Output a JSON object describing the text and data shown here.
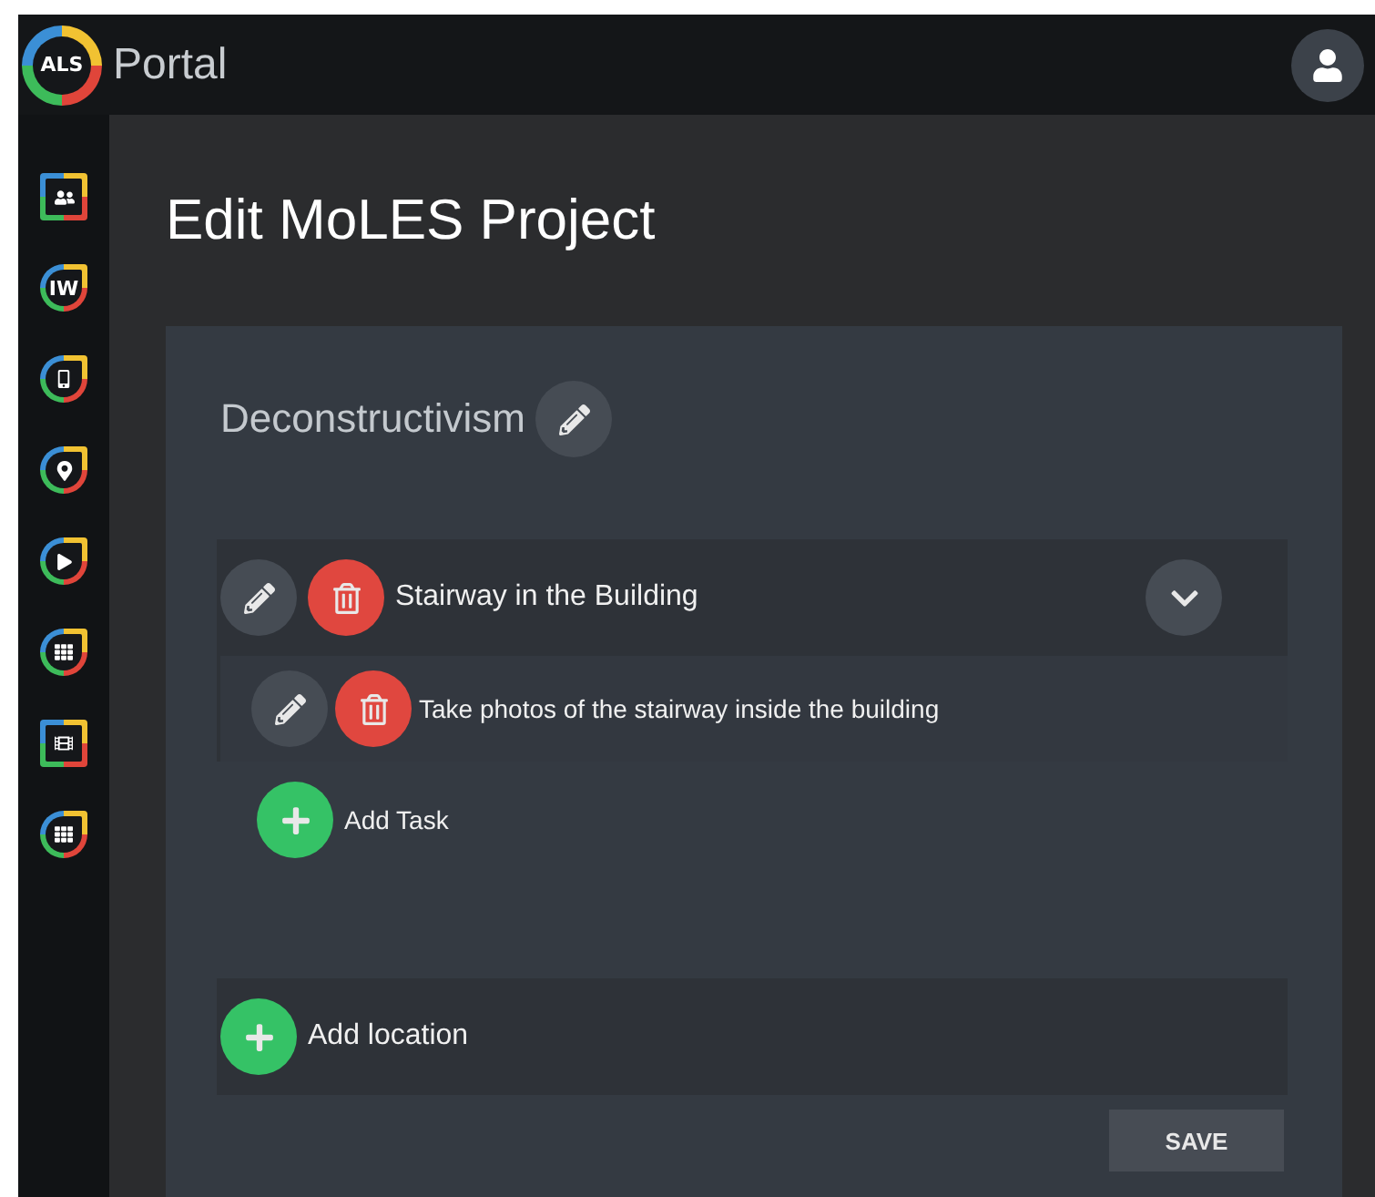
{
  "header": {
    "logo": "ALS",
    "title": "Portal"
  },
  "sidebar": {
    "items": [
      {
        "kind": "people"
      },
      {
        "kind": "text",
        "label": "IW"
      },
      {
        "kind": "device"
      },
      {
        "kind": "pin"
      },
      {
        "kind": "play"
      },
      {
        "kind": "grid"
      },
      {
        "kind": "clapper"
      },
      {
        "kind": "grid"
      }
    ]
  },
  "page_title": "Edit MoLES Project",
  "project": {
    "name": "Deconstructivism",
    "locations": [
      {
        "name": "Stairway in the Building",
        "expanded": true,
        "tasks": [
          {
            "name": "Take photos of the stairway inside the building"
          }
        ],
        "add_task": "Add Task"
      }
    ],
    "add_location": "Add location",
    "save": "SAVE"
  }
}
